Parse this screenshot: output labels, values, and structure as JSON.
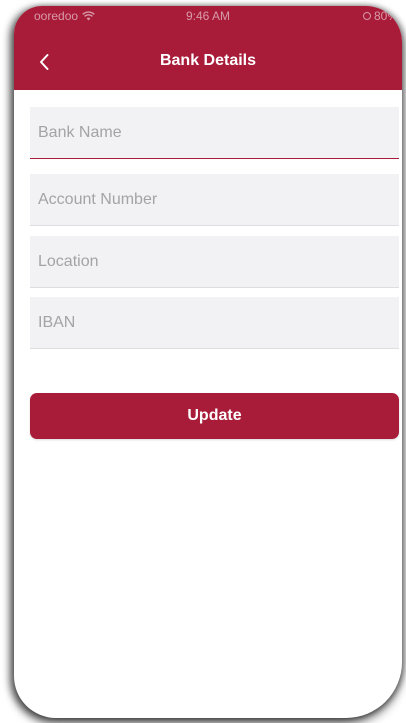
{
  "status_bar": {
    "carrier": "ooredoo",
    "time": "9:46 AM",
    "battery": "80%"
  },
  "header": {
    "title": "Bank Details",
    "back_icon": "chevron-left-icon"
  },
  "form": {
    "fields": [
      {
        "placeholder": "Bank Name",
        "value": ""
      },
      {
        "placeholder": "Account Number",
        "value": ""
      },
      {
        "placeholder": "Location",
        "value": ""
      },
      {
        "placeholder": "IBAN",
        "value": ""
      }
    ],
    "submit_label": "Update"
  },
  "colors": {
    "brand": "#a81c3a",
    "field_bg": "#f2f2f4",
    "placeholder": "#a3a3a8"
  }
}
